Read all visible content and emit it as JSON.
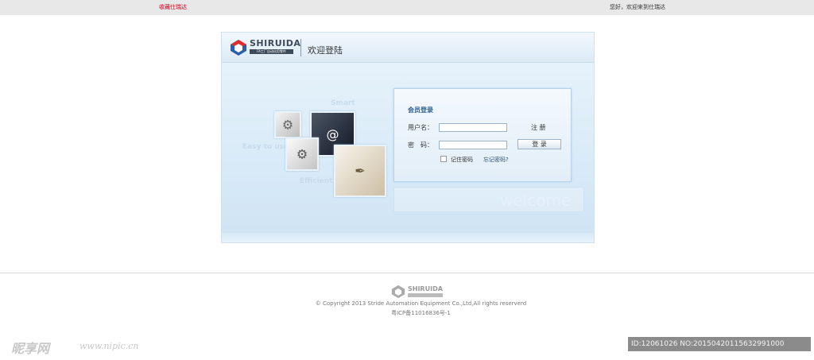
{
  "topbar": {
    "favorite_link": "收藏仕瑞达",
    "greeting": "您好，欢迎来到仕瑞达"
  },
  "header": {
    "brand": "SHIRUIDA",
    "tagline": "FA工厂自动化用零件",
    "title": "欢迎登陆"
  },
  "decor": {
    "ghost_words": [
      "Smart",
      "Easy to use",
      "Efficient"
    ],
    "welcome_word": "welcome"
  },
  "login": {
    "title": "会员登录",
    "username_label": "用户名：",
    "password_label": "密　码：",
    "username_value": "",
    "password_value": "",
    "register": "注 册",
    "submit": "登 录",
    "remember": "记住密码",
    "forgot": "忘记密码?"
  },
  "footer": {
    "brand": "SHIRUIDA",
    "copyright": "© Copyright 2013 Stride Automation Equipment Co.,Ltd,All rights reserverd",
    "icp": "粤ICP备11016836号-1"
  },
  "watermark": {
    "site": "昵享网",
    "url": "www.nipic.cn",
    "id_text": "ID:12061026 NO:20150420115632991000"
  },
  "colors": {
    "accent_red": "#d0021b",
    "login_title": "#2d5e8f"
  }
}
